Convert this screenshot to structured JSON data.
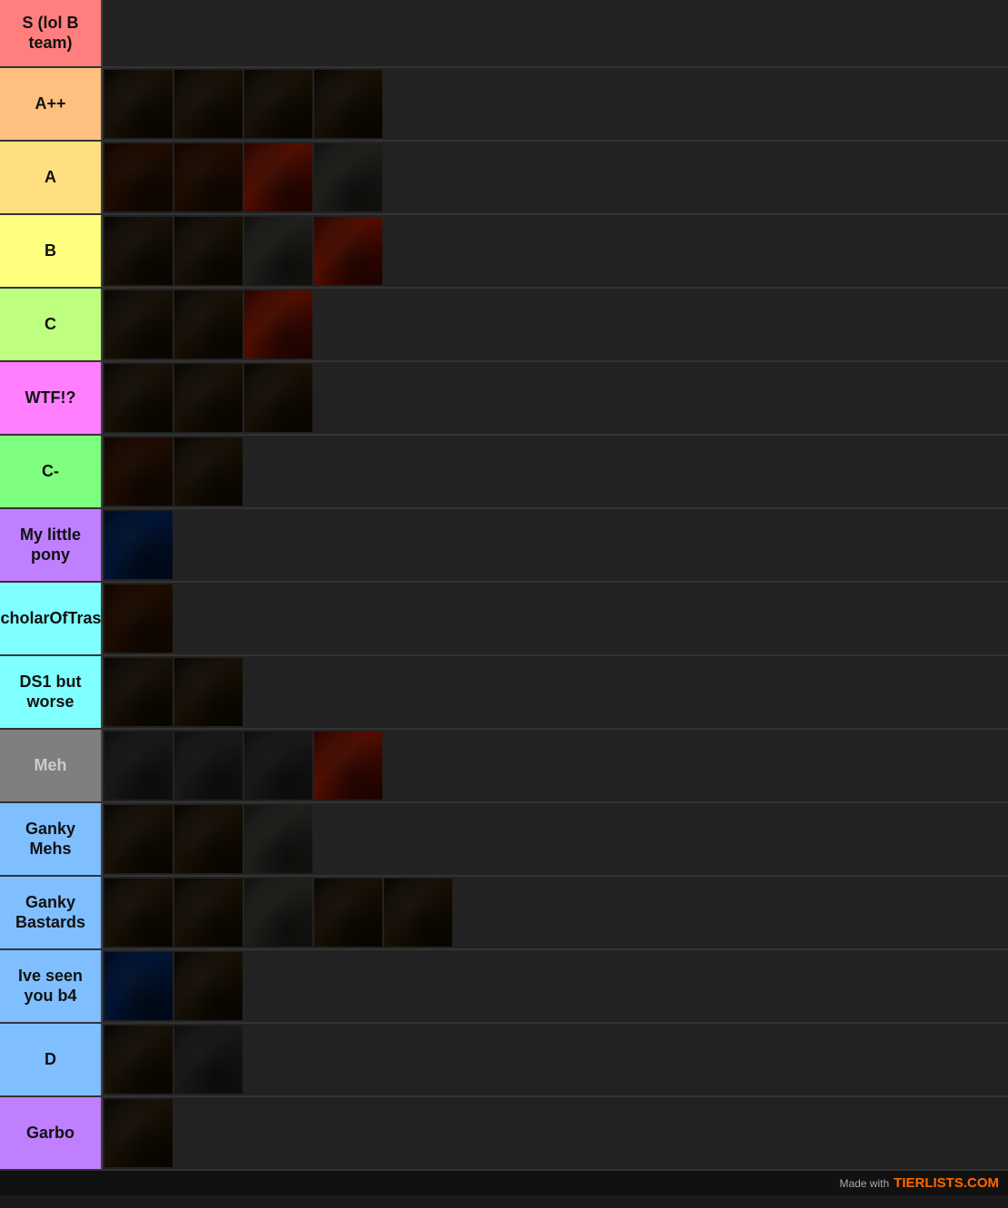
{
  "tiers": [
    {
      "id": "s",
      "label": "S (lol B team)",
      "color": "#ff7f7f",
      "textColor": "#111",
      "rowClass": "s-row",
      "images": []
    },
    {
      "id": "app",
      "label": "A++",
      "color": "#ffbf7f",
      "textColor": "#111",
      "rowClass": "app-row",
      "images": [
        "dark",
        "dark",
        "dark",
        "dark"
      ]
    },
    {
      "id": "a",
      "label": "A",
      "color": "#ffdf7f",
      "textColor": "#111",
      "rowClass": "a-row",
      "images": [
        "brown",
        "brown",
        "fire",
        "stone"
      ]
    },
    {
      "id": "b",
      "label": "B",
      "color": "#ffff7f",
      "textColor": "#111",
      "rowClass": "b-row",
      "images": [
        "dark",
        "dark",
        "stone",
        "fire"
      ]
    },
    {
      "id": "c",
      "label": "C",
      "color": "#bfff7f",
      "textColor": "#111",
      "rowClass": "c-row",
      "images": [
        "dark",
        "dark",
        "fire"
      ]
    },
    {
      "id": "wtf",
      "label": "WTF!?",
      "color": "#ff7fff",
      "textColor": "#111",
      "rowClass": "wtf-row",
      "images": [
        "dark",
        "dark",
        "dark"
      ]
    },
    {
      "id": "cminus",
      "label": "C-",
      "color": "#7fff7f",
      "textColor": "#111",
      "rowClass": "cminus-row",
      "images": [
        "brown",
        "dark"
      ]
    },
    {
      "id": "mlp",
      "label": "My little pony",
      "color": "#bf7fff",
      "textColor": "#111",
      "rowClass": "mlp-row",
      "images": [
        "blue"
      ]
    },
    {
      "id": "scholar",
      "label": "ScholarOfTrash",
      "color": "#7fffff",
      "textColor": "#111",
      "rowClass": "scholar-row",
      "images": [
        "brown"
      ]
    },
    {
      "id": "ds1",
      "label": "DS1 but worse",
      "color": "#7fffff",
      "textColor": "#111",
      "rowClass": "ds1-row",
      "images": [
        "dark",
        "dark"
      ]
    },
    {
      "id": "meh",
      "label": "Meh",
      "color": "#7f7f7f",
      "textColor": "#ccc",
      "rowClass": "meh-row",
      "images": [
        "grey",
        "grey",
        "grey",
        "fire"
      ]
    },
    {
      "id": "ganky",
      "label": "Ganky Mehs",
      "color": "#7fbfff",
      "textColor": "#111",
      "rowClass": "ganky-row",
      "images": [
        "dark",
        "dark",
        "stone"
      ]
    },
    {
      "id": "gankyb",
      "label": "Ganky Bastards",
      "color": "#7fbfff",
      "textColor": "#111",
      "rowClass": "gankyb-row",
      "images": [
        "dark",
        "dark",
        "stone",
        "dark",
        "dark"
      ]
    },
    {
      "id": "seen",
      "label": "Ive seen you b4",
      "color": "#7fbfff",
      "textColor": "#111",
      "rowClass": "seen-row",
      "images": [
        "blue",
        "dark"
      ]
    },
    {
      "id": "d",
      "label": "D",
      "color": "#7fbfff",
      "textColor": "#111",
      "rowClass": "d-row",
      "images": [
        "dark",
        "grey"
      ]
    },
    {
      "id": "garbo",
      "label": "Garbo",
      "color": "#bf7fff",
      "textColor": "#111",
      "rowClass": "garbo-row",
      "images": [
        "dark"
      ]
    }
  ],
  "watermark": {
    "made_with": "Made with",
    "brand": "TIERLISTS.COM"
  }
}
